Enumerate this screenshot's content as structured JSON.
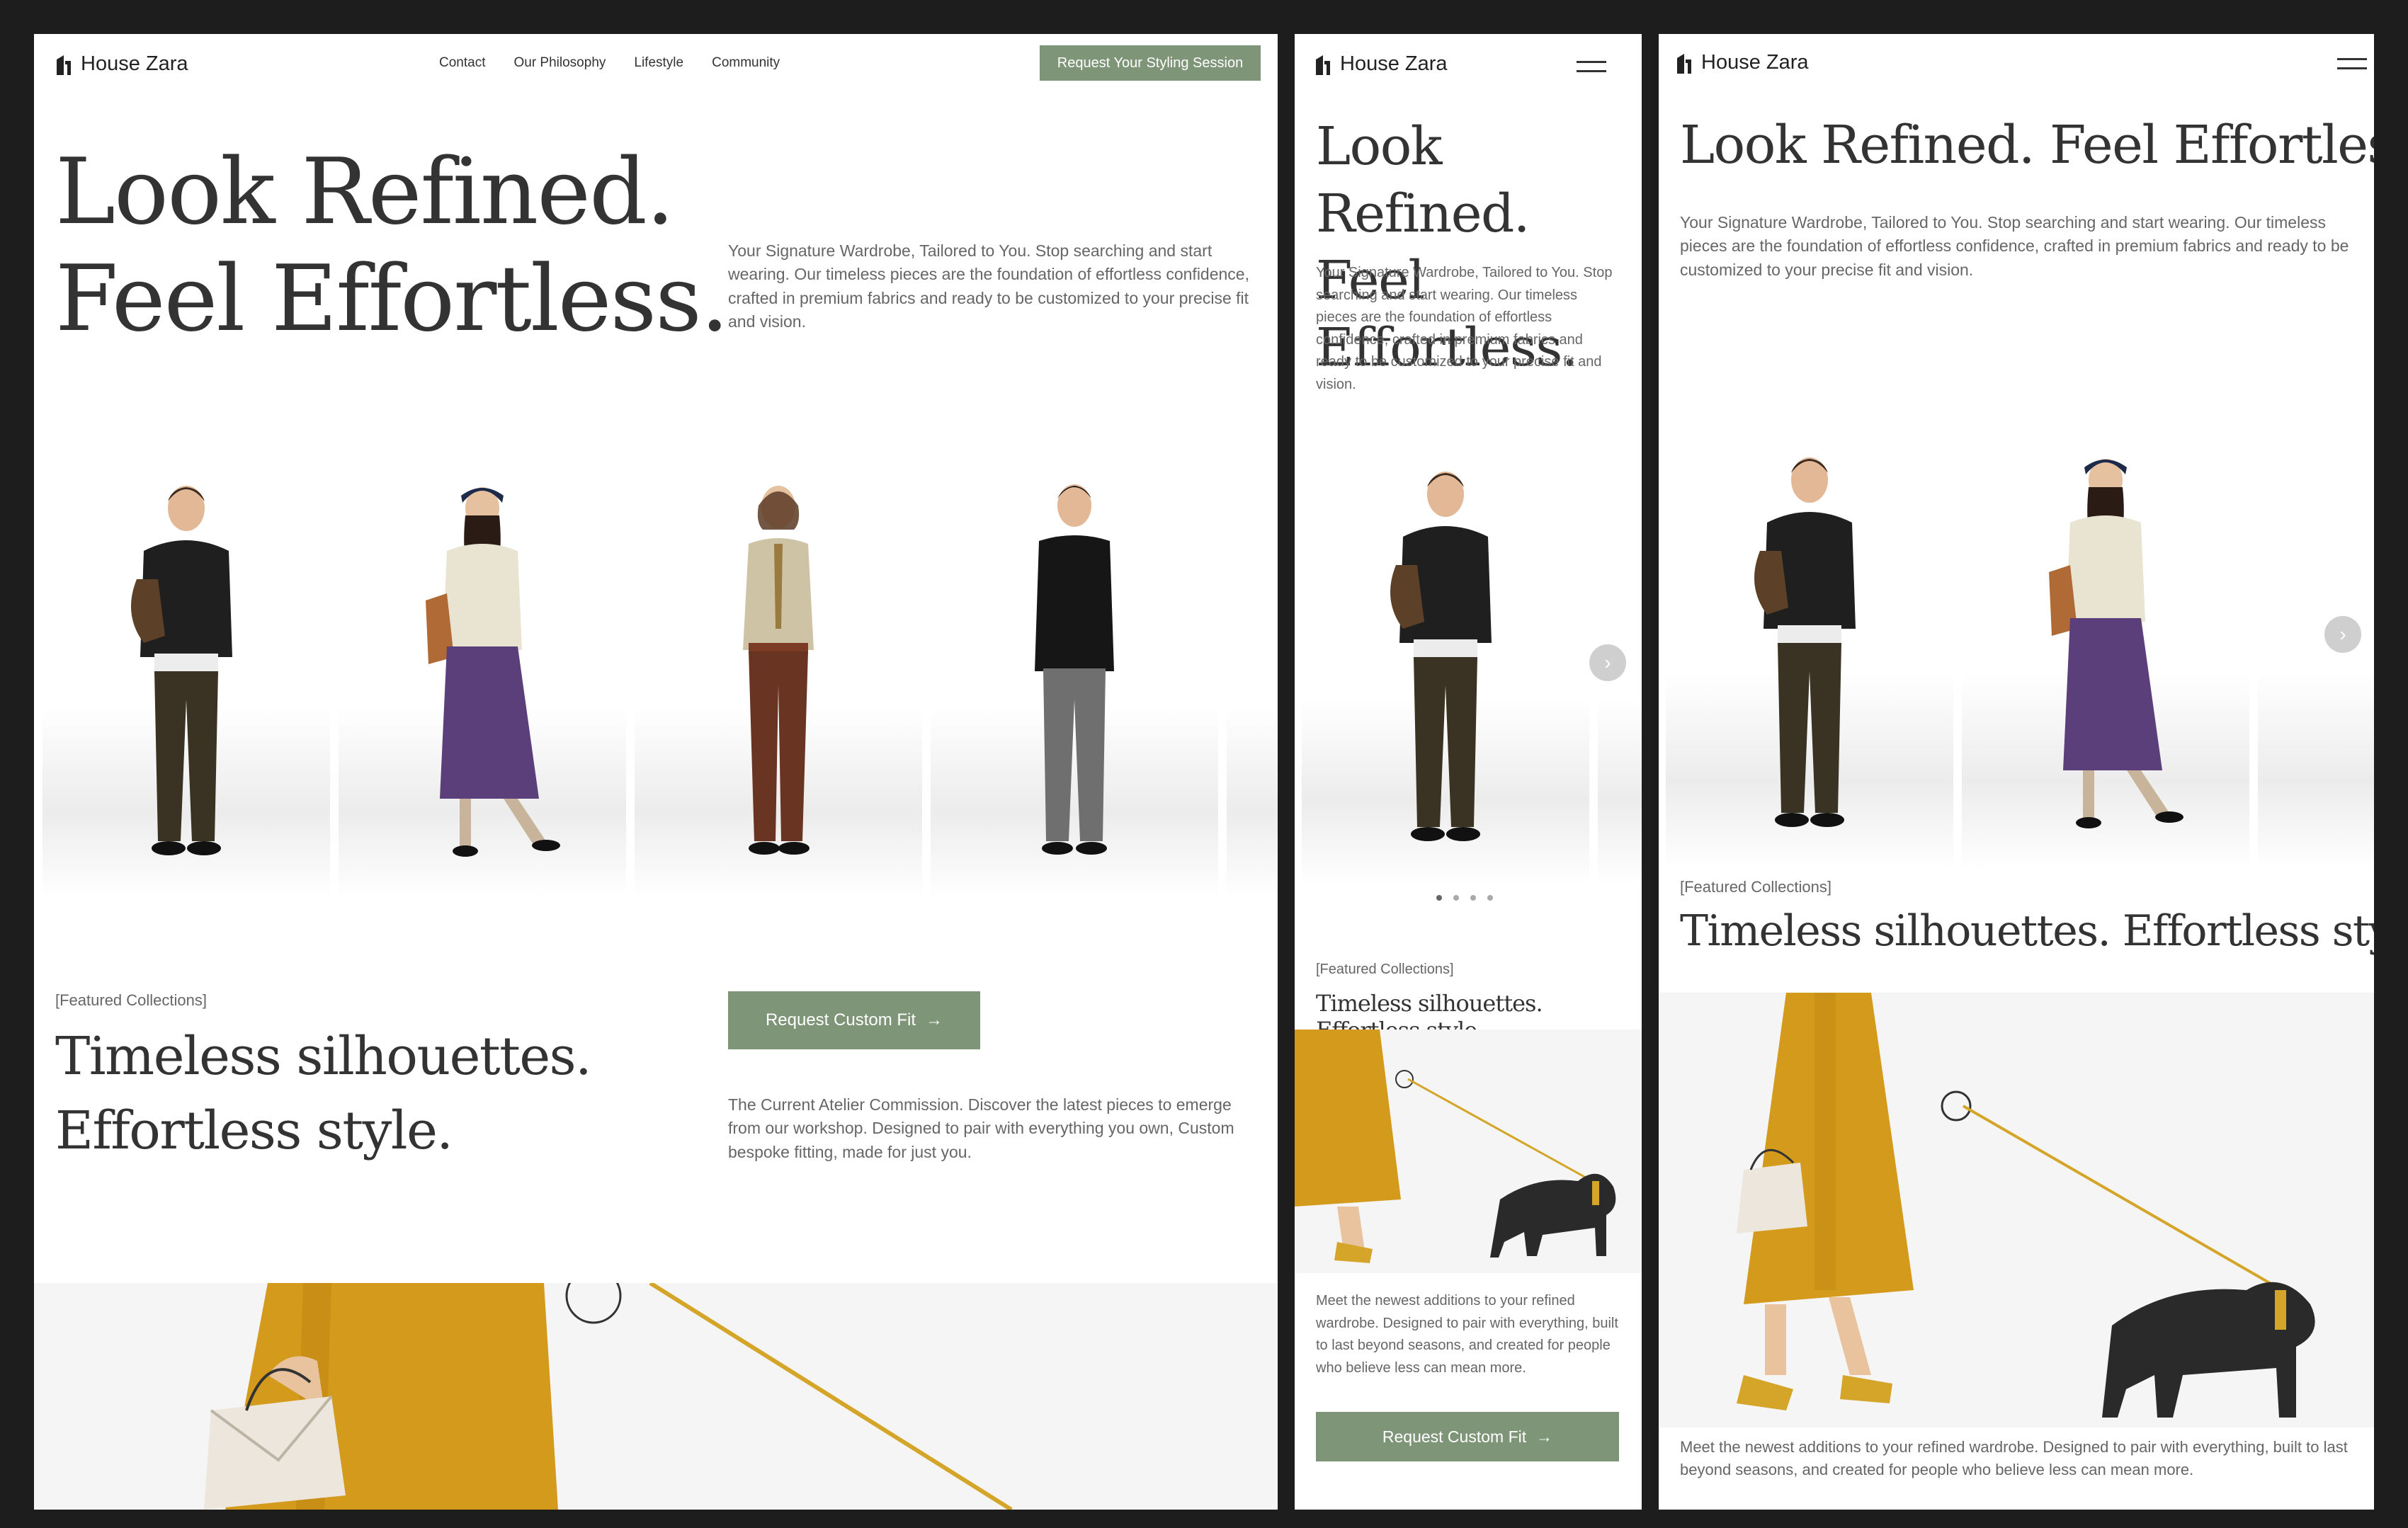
{
  "brand": {
    "name": "House Zara"
  },
  "nav": {
    "items": [
      "Contact",
      "Our Philosophy",
      "Lifestyle",
      "Community"
    ],
    "cta": "Request Your Styling Session"
  },
  "hero": {
    "title_line1": "Look Refined.",
    "title_line2": "Feel Effortless.",
    "title_full": "Look Refined. Feel Effortless.",
    "description": "Your Signature Wardrobe, Tailored to You. Stop searching and start wearing. Our timeless pieces are the foundation of effortless confidence, crafted in premium fabrics and ready to be customized to your precise fit and vision."
  },
  "featured": {
    "tag": "[Featured Collections]",
    "title_line1": "Timeless silhouettes.",
    "title_line2": "Effortless style.",
    "title_full": "Timeless silhouettes. Effortless style.",
    "button": "Request Custom Fit",
    "description": "The Current Atelier Commission. Discover the latest pieces to emerge from our workshop. Designed to pair with everything you own, Custom bespoke fitting, made for just you.",
    "mobile_description": "Meet the newest additions to your refined wardrobe. Designed to pair with everything, built to last beyond seasons, and created for people who believe less can mean more."
  },
  "icons": {
    "logo": "house-logo-icon",
    "menu": "hamburger-menu-icon",
    "next": "chevron-right-icon",
    "arrow": "arrow-right-icon"
  },
  "colors": {
    "accent": "#7e9578",
    "coat": "#d49a1c",
    "background": "#1d1d1d"
  }
}
